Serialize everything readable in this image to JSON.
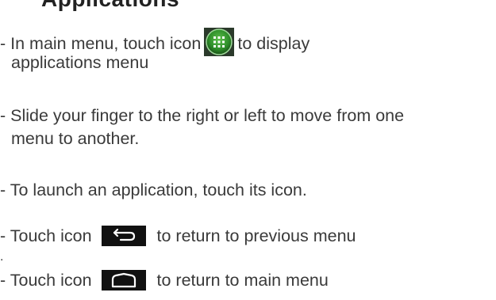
{
  "header": {
    "title_partial": "Applications"
  },
  "instructions": {
    "item1_prefix": "- In main menu, touch icon",
    "item1_suffix": "to display",
    "item1_cont": "applications menu",
    "item2_line1": "- Slide your finger to the right or left to move from one",
    "item2_line2": "menu to another.",
    "item3": "- To launch an application, touch its icon.",
    "item4_prefix": "- Touch icon",
    "item4_suffix": "to return to previous menu",
    "separator_dot": ".",
    "item5_prefix": "- Touch icon",
    "item5_suffix": "to return to main menu"
  },
  "icons": {
    "apps": "apps-grid-icon",
    "back": "back-arrow-icon",
    "home": "home-icon"
  },
  "colors": {
    "text": "#3a3a3a",
    "apps_icon_green": "#2f8f2a",
    "icon_bar": "#111111",
    "icon_glyph": "#ffffff"
  }
}
